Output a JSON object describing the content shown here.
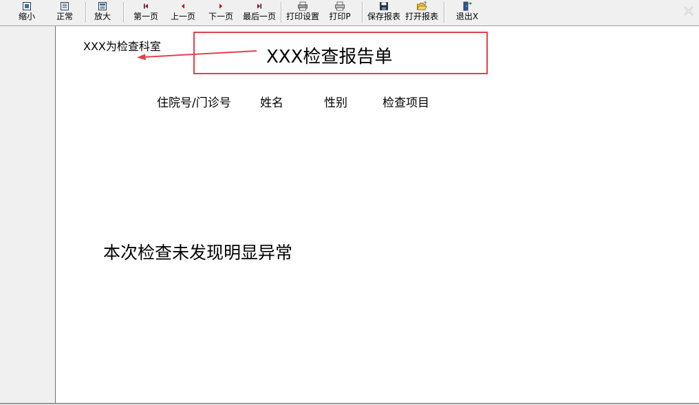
{
  "toolbar": {
    "buttons": [
      {
        "label": "缩小",
        "icon": "zoom-out-icon"
      },
      {
        "label": "正常",
        "icon": "page-normal-icon"
      },
      {
        "label": "放大",
        "icon": "zoom-in-icon"
      },
      {
        "label": "第一页",
        "icon": "first-page-icon"
      },
      {
        "label": "上一页",
        "icon": "prev-page-icon"
      },
      {
        "label": "下一页",
        "icon": "next-page-icon"
      },
      {
        "label": "最后一页",
        "icon": "last-page-icon"
      },
      {
        "label": "打印设置",
        "icon": "print-setup-icon"
      },
      {
        "label": "打印P",
        "icon": "printer-icon"
      },
      {
        "label": "保存报表",
        "icon": "save-disk-icon"
      },
      {
        "label": "打开报表",
        "icon": "open-folder-icon"
      },
      {
        "label": "退出X",
        "icon": "exit-door-icon"
      }
    ]
  },
  "report": {
    "dept_label": "XXX为检查科室",
    "title": "XXX检查报告单",
    "columns": [
      "住院号/门诊号",
      "姓名",
      "性别",
      "检查项目"
    ],
    "result": "本次检查未发现明显异常"
  },
  "colors": {
    "annotation_red": "#e53e4a",
    "nav_arrow": "#c00000"
  }
}
